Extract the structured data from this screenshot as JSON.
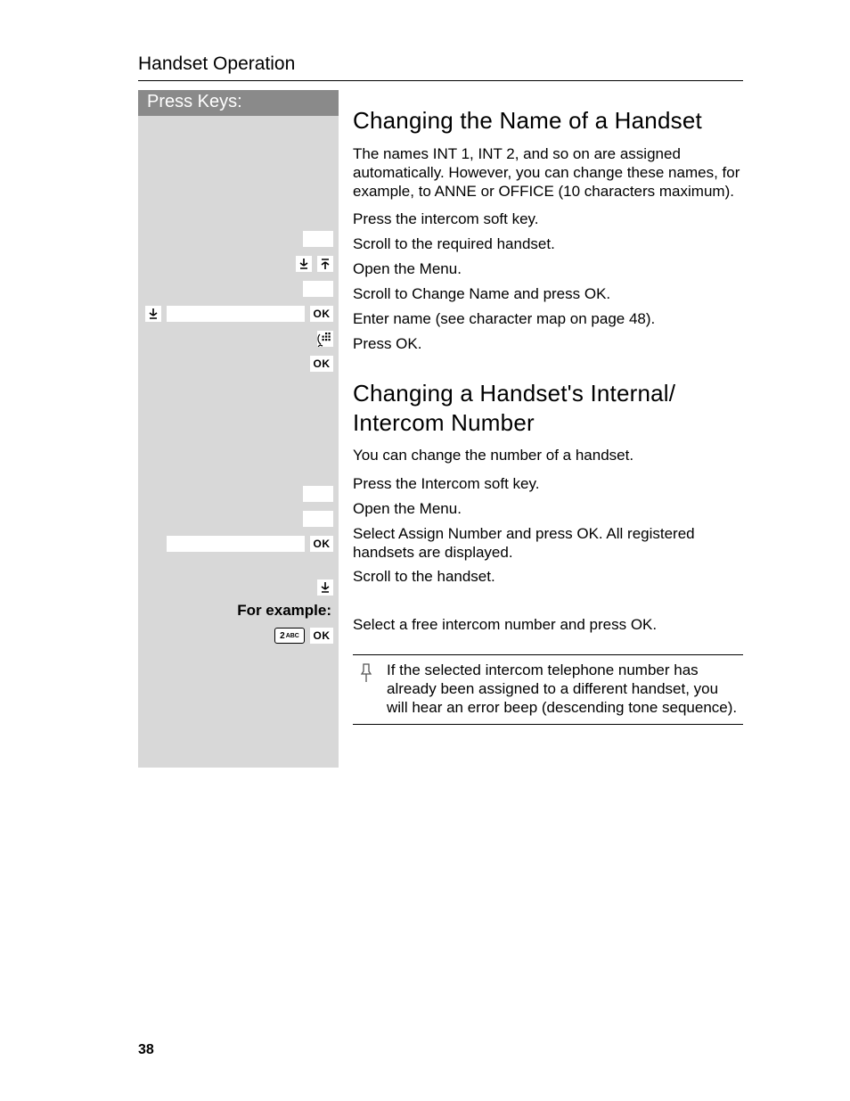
{
  "running_head": "Handset Operation",
  "sidebar": {
    "title": "Press Keys:",
    "example_label": "For example:",
    "ok": "OK",
    "key2": "2",
    "key2_sup": "ABC"
  },
  "s1": {
    "title": "Changing the Name of a Handset",
    "intro": "The names INT 1, INT 2, and so on are assigned automatically. However, you can change these names, for example, to ANNE or OFFICE (10 characters maximum).",
    "steps": {
      "a": "Press the intercom soft key.",
      "b": "Scroll to the required handset.",
      "c": "Open the Menu.",
      "d": "Scroll to Change Name and press OK.",
      "e": "Enter name (see character map on page 48).",
      "f": "Press OK."
    }
  },
  "s2": {
    "title": "Changing a Handset's Internal/ Intercom Number",
    "intro": "You can change the number of a handset.",
    "steps": {
      "a": "Press the Intercom soft key.",
      "b": "Open the Menu.",
      "c": "Select Assign Number and press OK. All registered handsets are displayed.",
      "d": "Scroll to the handset.",
      "e": "Select a free intercom number and press OK."
    },
    "note": "If the selected intercom telephone number has already been assigned to a different handset, you will hear an error beep (descending tone sequence)."
  },
  "page_number": "38"
}
